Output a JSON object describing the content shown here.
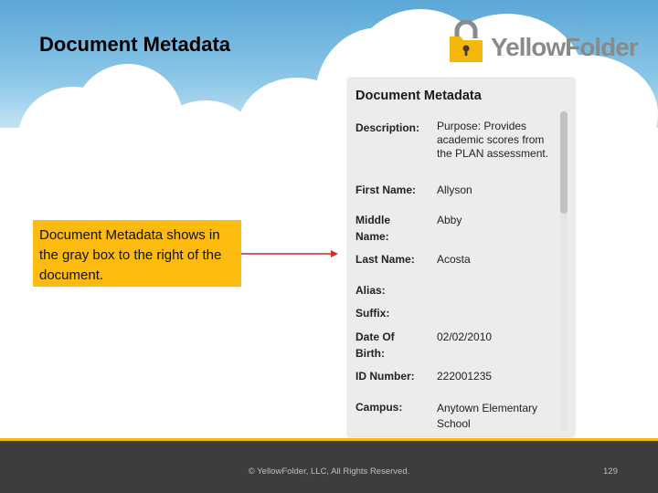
{
  "slide": {
    "title": "Document Metadata",
    "logo_text": "YellowFolder",
    "callout": "Document Metadata shows in the gray box to the right of the document.",
    "footer": "© YellowFolder, LLC, All Rights Reserved.",
    "page_number": "129"
  },
  "panel": {
    "title": "Document Metadata",
    "fields": [
      {
        "label": "Description:",
        "value": "Purpose: Provides academic scores from the PLAN assessment."
      },
      {
        "label": "First Name:",
        "value": "Allyson"
      },
      {
        "label": "Middle Name:",
        "value": "Abby"
      },
      {
        "label": "Last Name:",
        "value": "Acosta"
      },
      {
        "label": "Alias:",
        "value": ""
      },
      {
        "label": "Suffix:",
        "value": ""
      },
      {
        "label": "Date Of Birth:",
        "value": "02/02/2010"
      },
      {
        "label": "ID Number:",
        "value": "222001235"
      },
      {
        "label": "Campus:",
        "value": "Anytown Elementary School"
      }
    ]
  },
  "colors": {
    "callout_bg": "#fdbb0f",
    "arrow": "#d42a2a",
    "footer_bg": "#3d3d3d",
    "footer_accent": "#f5b70c",
    "panel_bg": "#ececec"
  },
  "icons": [
    "padlock-folder-icon",
    "arrow-right-icon"
  ]
}
